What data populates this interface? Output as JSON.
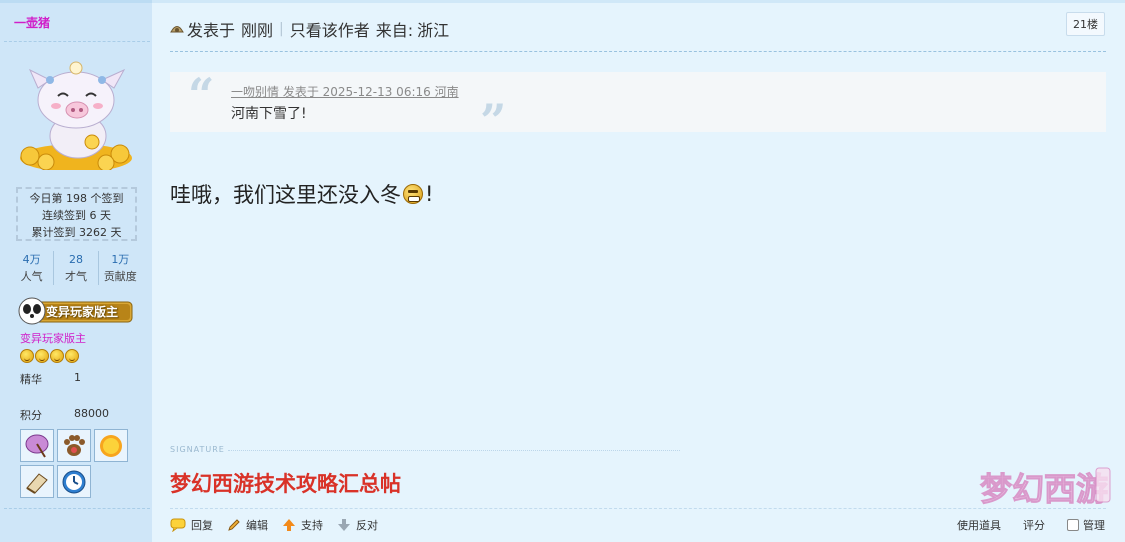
{
  "sidebar": {
    "username": "一壶猪",
    "checkin": {
      "today": "今日第 198 个签到",
      "streak": "连续签到 6 天",
      "total": "累计签到 3262 天"
    },
    "stats": [
      {
        "value": "4万",
        "label": "人气"
      },
      {
        "value": "28",
        "label": "才气"
      },
      {
        "value": "1万",
        "label": "贡献度"
      }
    ],
    "badge_text": "变异玩家版主",
    "rank": "变异玩家版主",
    "essence_label": "精华",
    "essence_value": "1",
    "points_label": "积分",
    "points_value": "88000",
    "medal_icons": [
      "umbrella-icon",
      "paw-icon",
      "sun-icon",
      "book-icon",
      "clock-icon"
    ]
  },
  "post": {
    "posted_prefix": "发表于",
    "posted_time": "刚刚",
    "only_author": "只看该作者",
    "from_label": "来自:",
    "from_place": "浙江",
    "floor": "21楼",
    "quote_meta": "一吻别情 发表于 2025-12-13 06:16 河南",
    "quote_text": "河南下雪了!",
    "body_before": "哇哦，我们这里还没入冬",
    "body_after": "!",
    "signature_label": "SIGNATURE",
    "signature_link": "梦幻西游技术攻略汇总帖",
    "watermark_text": "梦幻西游"
  },
  "actions": {
    "reply": "回复",
    "edit": "编辑",
    "support": "支持",
    "oppose": "反对",
    "use_item": "使用道具",
    "rate": "评分",
    "manage": "管理"
  },
  "colors": {
    "username": "#d01fc9",
    "signature": "#d93228",
    "sidebar_bg": "#cfe6f8",
    "main_bg": "#e5f4fd"
  }
}
